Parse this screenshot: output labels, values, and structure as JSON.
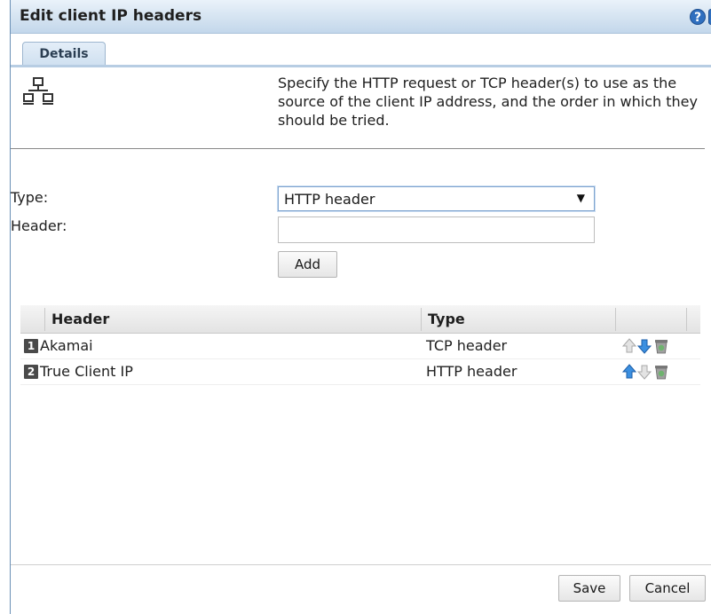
{
  "dialog": {
    "title": "Edit client IP headers",
    "help_icon": "?",
    "close_icon": "x"
  },
  "tabs": [
    {
      "label": "Details"
    }
  ],
  "intro": {
    "icon": "network-icon",
    "text": "Specify the HTTP request or TCP header(s) to use as the source of the client IP address, and the order in which they should be tried."
  },
  "form": {
    "type_label": "Type:",
    "type_value": "HTTP header",
    "header_label": "Header:",
    "header_value": "",
    "header_placeholder": "",
    "add_label": "Add"
  },
  "table": {
    "columns": [
      "Header",
      "Type"
    ],
    "rows": [
      {
        "num": "1",
        "header": "Akamai",
        "type": "TCP header",
        "up_enabled": false,
        "down_enabled": true
      },
      {
        "num": "2",
        "header": "True Client IP",
        "type": "HTTP header",
        "up_enabled": true,
        "down_enabled": false
      }
    ]
  },
  "footer": {
    "save_label": "Save",
    "cancel_label": "Cancel"
  },
  "colors": {
    "title_bar": "#d4e3f1",
    "arrow_enabled": "#3b8fe0",
    "arrow_disabled": "#c8c8c8",
    "trash": "#5f8f5f"
  }
}
